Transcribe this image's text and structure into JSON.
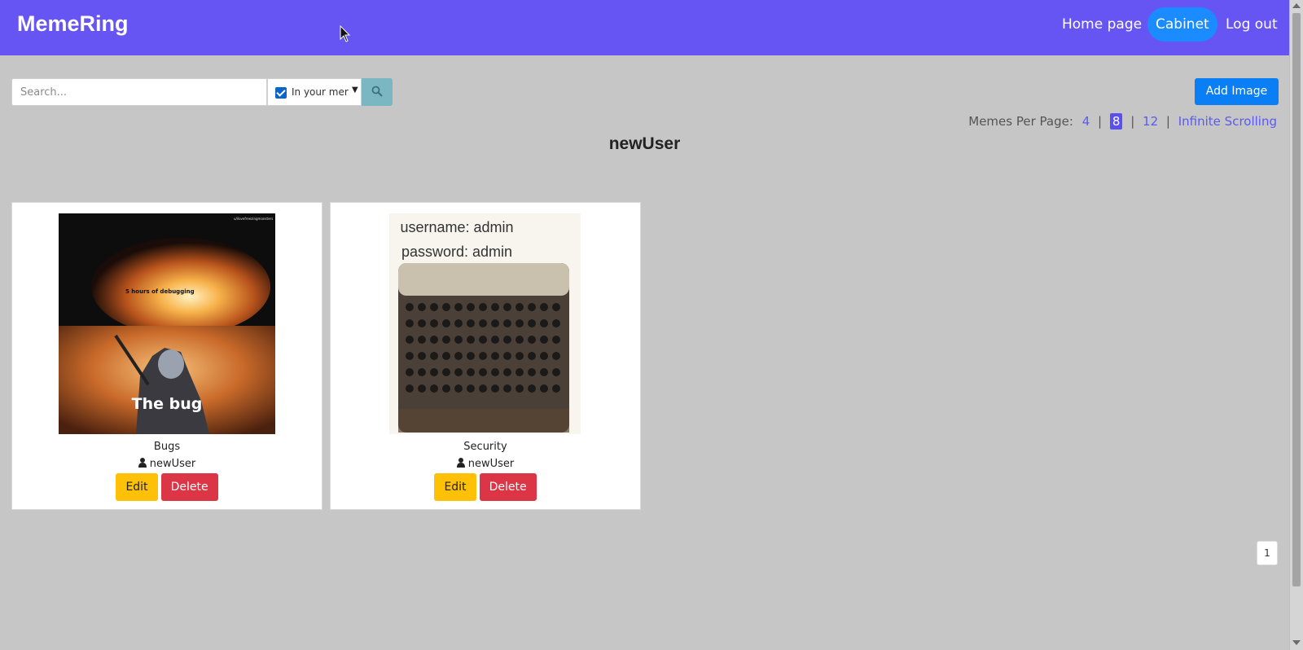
{
  "app": {
    "brand": "MemeRing",
    "nav": {
      "home": "Home page",
      "cabinet": "Cabinet",
      "logout": "Log out"
    }
  },
  "search": {
    "placeholder": "Search...",
    "value": "",
    "scope_label": "In your mer",
    "scope_checked": true,
    "button_icon": "search-icon"
  },
  "toolbar": {
    "add_image_label": "Add Image"
  },
  "per_page": {
    "label": "Memes Per Page:",
    "options": [
      "4",
      "8",
      "12",
      "Infinite Scrolling"
    ],
    "selected": "8",
    "separator": "|"
  },
  "profile": {
    "username": "newUser"
  },
  "memes": [
    {
      "title": "Bugs",
      "author": "newUser",
      "edit_label": "Edit",
      "delete_label": "Delete",
      "image": {
        "top_caption": "5 hours of debugging",
        "watermark": "u/ilovefreezingmonsters",
        "bottom_caption": "The bug"
      }
    },
    {
      "title": "Security",
      "author": "newUser",
      "edit_label": "Edit",
      "delete_label": "Delete",
      "image": {
        "line1": "username: admin",
        "line2": "password: admin"
      }
    }
  ],
  "pagination": {
    "current_page": "1"
  },
  "colors": {
    "navbar": "#6655f2",
    "cabinet_active": "#1a8cff",
    "add_button": "#0a7ef5",
    "edit_button": "#ffc107",
    "delete_button": "#dc3545",
    "page_background": "#c6c6c6"
  }
}
